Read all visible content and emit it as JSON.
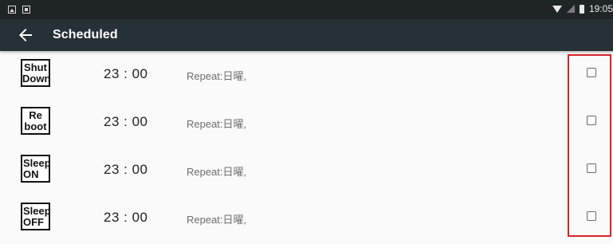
{
  "status_bar": {
    "time": "19:05",
    "icons": [
      "image-notification-icon",
      "app-notification-icon",
      "wifi-icon",
      "signal-icon",
      "battery-icon"
    ]
  },
  "toolbar": {
    "back_icon": "arrow-left-icon",
    "title": "Scheduled"
  },
  "rows": [
    {
      "icon_line1": "Shut",
      "icon_line2": "Down",
      "time": "23 : 00",
      "repeat": "Repeat:日曜,",
      "checked": false
    },
    {
      "icon_line1": "Re",
      "icon_line2": "boot",
      "time": "23 : 00",
      "repeat": "Repeat:日曜,",
      "checked": false
    },
    {
      "icon_line1": "Sleep",
      "icon_line2": "ON",
      "time": "23 : 00",
      "repeat": "Repeat:日曜,",
      "checked": false
    },
    {
      "icon_line1": "Sleep",
      "icon_line2": "OFF",
      "time": "23 : 00",
      "repeat": "Repeat:日曜,",
      "checked": false
    }
  ],
  "colors": {
    "status_bar_bg": "#1f2527",
    "toolbar_bg": "#263136",
    "highlight": "#d8232a",
    "list_bg": "#fafafa"
  }
}
